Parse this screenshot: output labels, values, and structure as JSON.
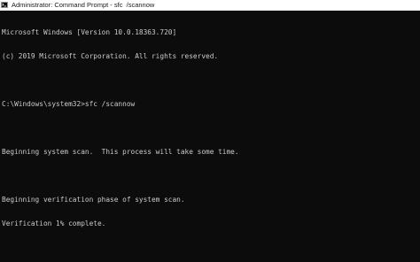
{
  "window": {
    "title": "Administrator: Command Prompt - sfc  /scannow",
    "icon": "cmd-icon"
  },
  "console": {
    "lines": [
      "Microsoft Windows [Version 10.0.18363.720]",
      "(c) 2019 Microsoft Corporation. All rights reserved.",
      "",
      "C:\\Windows\\system32>sfc /scannow",
      "",
      "Beginning system scan.  This process will take some time.",
      "",
      "Beginning verification phase of system scan.",
      "Verification 1% complete."
    ]
  },
  "colors": {
    "background": "#0c0c0c",
    "text": "#cccccc",
    "titlebar": "#ffffff"
  }
}
